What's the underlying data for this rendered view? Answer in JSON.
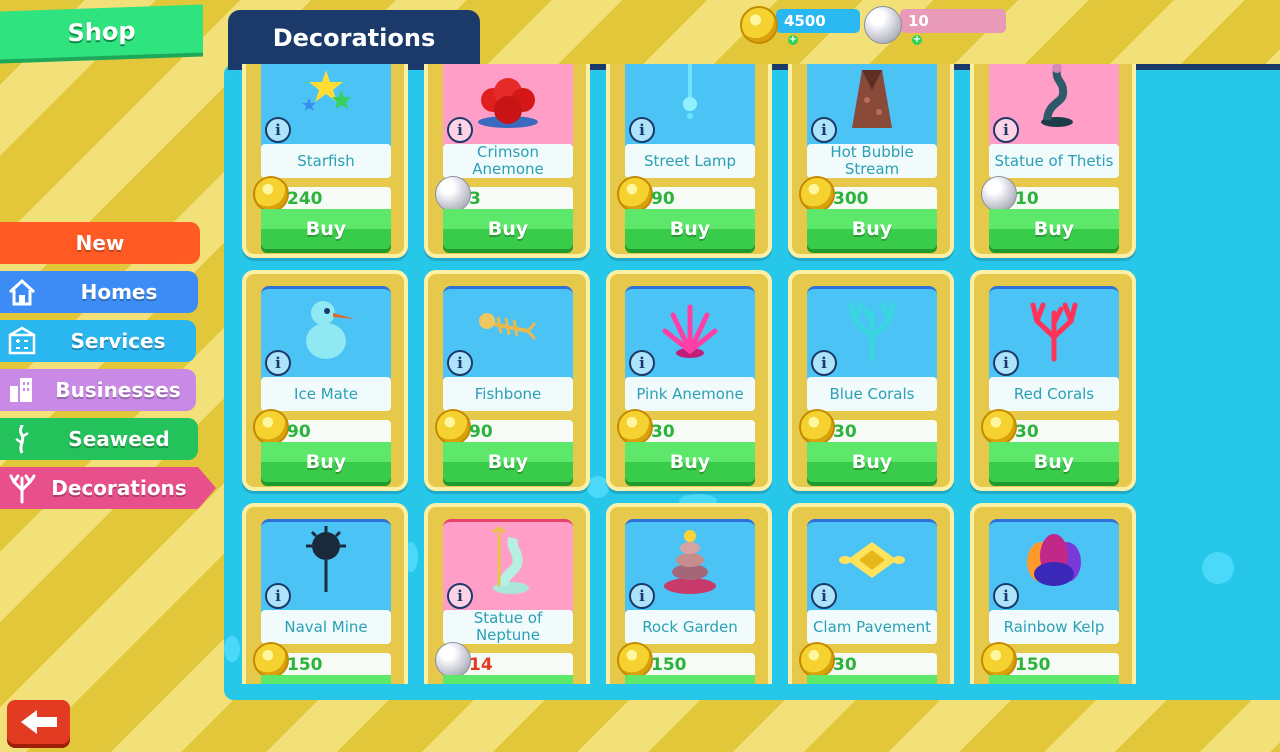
{
  "header": {
    "shop_label": "Shop",
    "section_title": "Decorations"
  },
  "currency": {
    "coins": "4500",
    "pearls": "10",
    "coin_bar_color": "#29b8f0",
    "pearl_bar_color": "#e89ab8"
  },
  "sidebar": {
    "items": [
      {
        "label": "New",
        "icon": "none",
        "color": "#ff5a24"
      },
      {
        "label": "Homes",
        "icon": "house-icon",
        "color": "#3d8cf5"
      },
      {
        "label": "Services",
        "icon": "services-icon",
        "color": "#2ab6ee"
      },
      {
        "label": "Businesses",
        "icon": "buildings-icon",
        "color": "#c98ae6"
      },
      {
        "label": "Seaweed",
        "icon": "seaweed-icon",
        "color": "#23c25a"
      },
      {
        "label": "Decorations",
        "icon": "coral-icon",
        "color": "#e8508c"
      }
    ]
  },
  "products": [
    {
      "name": "Starfish",
      "price": "240",
      "currency": "coin",
      "bg": "blue",
      "art": "starfish-icon"
    },
    {
      "name": "Crimson Anemone",
      "price": "3",
      "currency": "pearl",
      "bg": "pink",
      "art": "crimson-anemone-icon"
    },
    {
      "name": "Street Lamp",
      "price": "90",
      "currency": "coin",
      "bg": "blue",
      "art": "street-lamp-icon"
    },
    {
      "name": "Hot Bubble Stream",
      "price": "300",
      "currency": "coin",
      "bg": "blue",
      "art": "hot-bubble-stream-icon"
    },
    {
      "name": "Statue of Thetis",
      "price": "10",
      "currency": "pearl",
      "bg": "pink",
      "art": "statue-thetis-icon"
    },
    {
      "name": "Ice Mate",
      "price": "90",
      "currency": "coin",
      "bg": "blue",
      "art": "ice-mate-icon"
    },
    {
      "name": "Fishbone",
      "price": "90",
      "currency": "coin",
      "bg": "blue",
      "art": "fishbone-icon"
    },
    {
      "name": "Pink Anemone",
      "price": "30",
      "currency": "coin",
      "bg": "blue",
      "art": "pink-anemone-icon"
    },
    {
      "name": "Blue Corals",
      "price": "30",
      "currency": "coin",
      "bg": "blue",
      "art": "blue-corals-icon"
    },
    {
      "name": "Red Corals",
      "price": "30",
      "currency": "coin",
      "bg": "blue",
      "art": "red-corals-icon"
    },
    {
      "name": "Naval Mine",
      "price": "150",
      "currency": "coin",
      "bg": "blue",
      "art": "naval-mine-icon"
    },
    {
      "name": "Statue of Neptune",
      "price": "14",
      "currency": "pearl",
      "bg": "pink",
      "art": "statue-neptune-icon",
      "price_red": true
    },
    {
      "name": "Rock Garden",
      "price": "150",
      "currency": "coin",
      "bg": "blue",
      "art": "rock-garden-icon"
    },
    {
      "name": "Clam Pavement",
      "price": "30",
      "currency": "coin",
      "bg": "blue",
      "art": "clam-pavement-icon"
    },
    {
      "name": "Rainbow Kelp",
      "price": "150",
      "currency": "coin",
      "bg": "blue",
      "art": "rainbow-kelp-icon"
    }
  ],
  "labels": {
    "buy": "Buy",
    "info": "i"
  },
  "back_icon": "back-arrow-icon"
}
